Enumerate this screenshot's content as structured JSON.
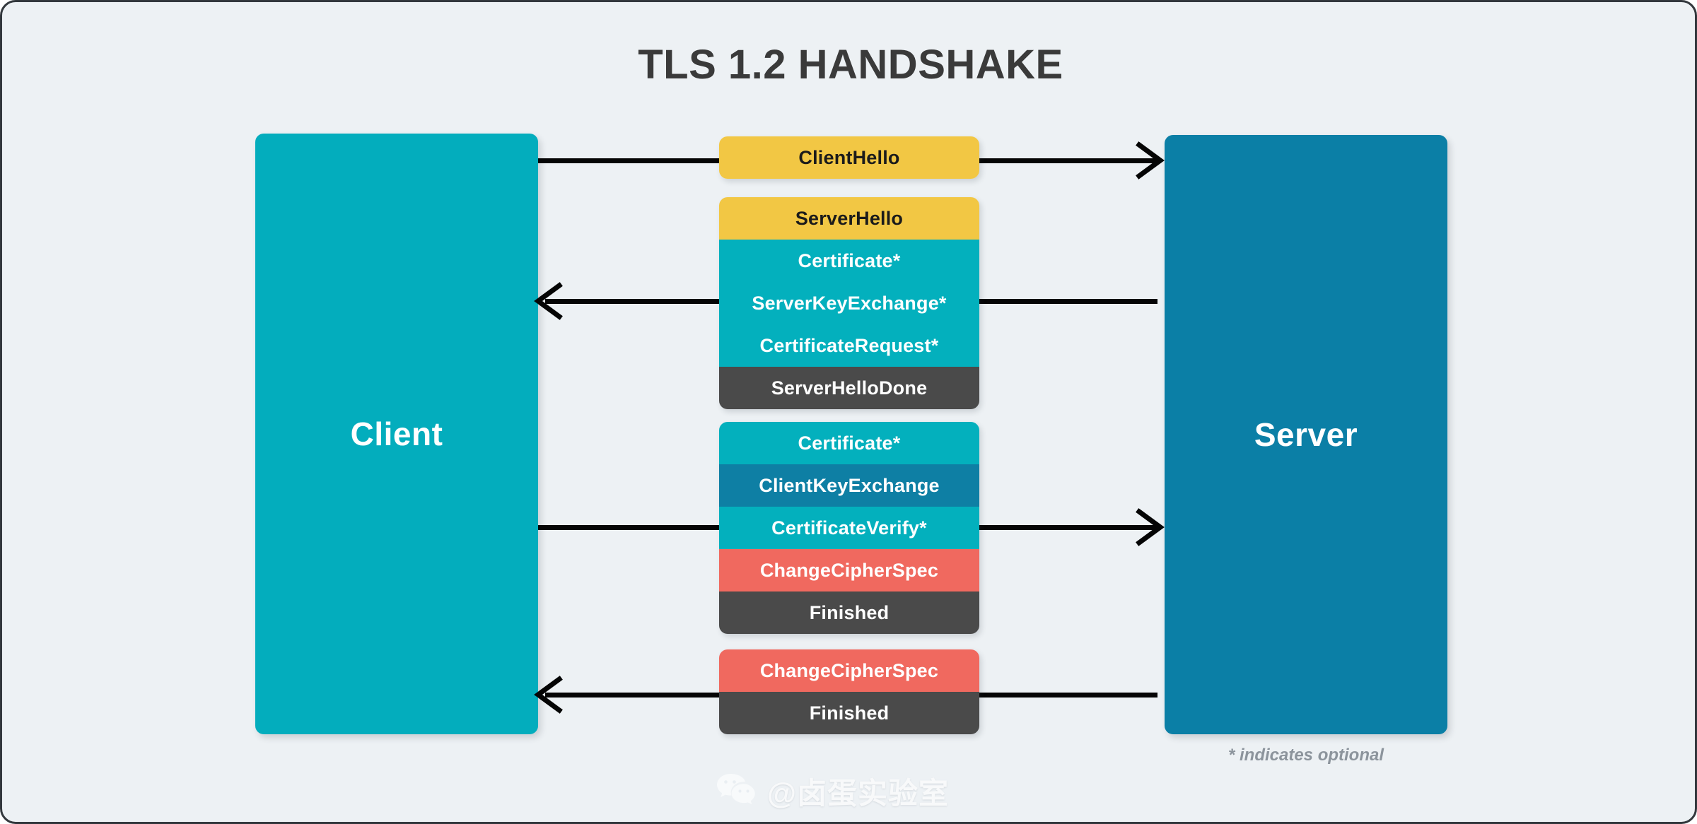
{
  "page": {
    "title": "TLS 1.2 HANDSHAKE",
    "background_color": "#edf1f4",
    "border_color": "#33383d"
  },
  "endpoints": {
    "client": {
      "label": "Client",
      "color": "#03adbd"
    },
    "server": {
      "label": "Server",
      "color": "#0b7fa6"
    }
  },
  "palette": {
    "yellow": "#f2c744",
    "teal": "#03b0bd",
    "blue": "#0e7fa4",
    "red": "#f0695f",
    "dark": "#4a4a4a",
    "arrow": "#050505"
  },
  "flows": [
    {
      "id": "flow-1",
      "direction": "client-to-server",
      "messages": [
        {
          "label": "ClientHello",
          "color": "yellow"
        }
      ]
    },
    {
      "id": "flow-2",
      "direction": "server-to-client",
      "messages": [
        {
          "label": "ServerHello",
          "color": "yellow"
        },
        {
          "label": "Certificate*",
          "color": "teal"
        },
        {
          "label": "ServerKeyExchange*",
          "color": "teal"
        },
        {
          "label": "CertificateRequest*",
          "color": "teal"
        },
        {
          "label": "ServerHelloDone",
          "color": "dark"
        }
      ]
    },
    {
      "id": "flow-3",
      "direction": "client-to-server",
      "messages": [
        {
          "label": "Certificate*",
          "color": "teal"
        },
        {
          "label": "ClientKeyExchange",
          "color": "blue"
        },
        {
          "label": "CertificateVerify*",
          "color": "teal"
        },
        {
          "label": "ChangeCipherSpec",
          "color": "red"
        },
        {
          "label": "Finished",
          "color": "dark"
        }
      ]
    },
    {
      "id": "flow-4",
      "direction": "server-to-client",
      "messages": [
        {
          "label": "ChangeCipherSpec",
          "color": "red"
        },
        {
          "label": "Finished",
          "color": "dark"
        }
      ]
    }
  ],
  "footnote": "* indicates optional",
  "watermark": {
    "icon": "wechat-icon",
    "text": "@卤蛋实验室"
  }
}
